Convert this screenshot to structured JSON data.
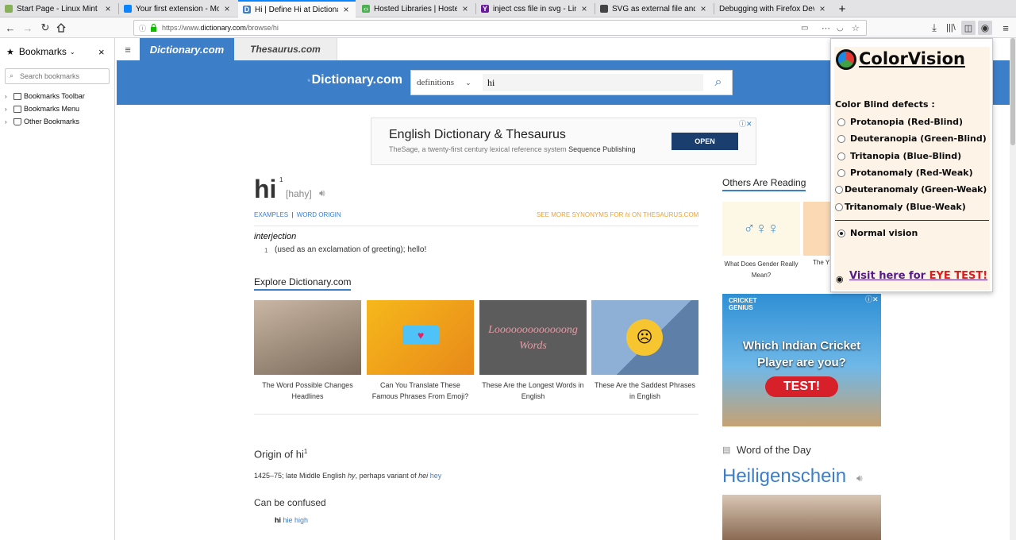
{
  "tabs": [
    {
      "title": "Start Page - Linux Mint",
      "fav_color": "#87b158"
    },
    {
      "title": "Your first extension - Mozilla",
      "fav_color": "#0a84ff"
    },
    {
      "title": "Hi | Define Hi at Dictionary.co",
      "fav_color": "#3d7ec9"
    },
    {
      "title": "Hosted Libraries  |  Hosted Li",
      "fav_color": "#4caf50"
    },
    {
      "title": "inject css file in svg - LinuxMi",
      "fav_color": "#6a1b9a"
    },
    {
      "title": "SVG as external file and CSS -",
      "fav_color": "#444444"
    },
    {
      "title": "Debugging with Firefox Develope",
      "fav_color": "#cccccc"
    }
  ],
  "url": {
    "prefix": "https://www.",
    "domain": "dictionary.com",
    "path": "/browse/hi"
  },
  "sidebar": {
    "title": "Bookmarks",
    "search_placeholder": "Search bookmarks",
    "items": [
      {
        "label": "Bookmarks Toolbar"
      },
      {
        "label": "Bookmarks Menu"
      },
      {
        "label": "Other Bookmarks"
      }
    ]
  },
  "site": {
    "tab_dictionary": "Dictionary.com",
    "tab_thesaurus": "Thesaurus.com",
    "logo_text": "Dictionary.com",
    "search_select": "definitions",
    "search_value": "hi"
  },
  "ad_top": {
    "title": "English Dictionary & Thesaurus",
    "subtitle": "TheSage, a twenty-first century lexical reference system",
    "sponsor": "Sequence Publishing",
    "button": "OPEN"
  },
  "entry": {
    "word": "hi",
    "superscript": "1",
    "pronunciation": "[hahy]",
    "nav_examples": "EXAMPLES",
    "nav_sep": "|",
    "nav_origin": "WORD ORIGIN",
    "synonyms_pre": "SEE MORE SYNONYMS FOR ",
    "synonyms_word": "hi",
    "synonyms_post": " ON THESAURUS.COM",
    "pos": "interjection",
    "def_num": "1",
    "definition": "(used as an exclamation of greeting); hello!"
  },
  "explore": {
    "heading": "Explore Dictionary.com",
    "items": [
      {
        "caption": "The Word Possible Changes Headlines",
        "color": "#9b8a7a"
      },
      {
        "caption": "Can You Translate These Famous Phrases From Emoji?",
        "color": "#f2a51b"
      },
      {
        "caption": "These Are the Longest Words in English",
        "color": "#5c5c5c",
        "overlay1": "Looooooooooooong",
        "overlay2": "Words"
      },
      {
        "caption": "These Are the Saddest Phrases in English",
        "color": "#7fa0c9"
      }
    ]
  },
  "origin": {
    "heading": "Origin of hi",
    "sup": "1",
    "text_pre": "1425–75; late Middle English ",
    "hy": "hy",
    "text_mid": ", perhaps variant of ",
    "hei": "hei",
    "hey": "hey"
  },
  "confused": {
    "heading": "Can be confused",
    "word": "hi",
    "hie": "hie",
    "high": "high"
  },
  "right_col": {
    "others_heading": "Others Are Reading",
    "card1_caption": "What Does Gender Really Mean?",
    "card2_caption": "The Y",
    "ad2_brand": "CRICKET GENIUS",
    "ad2_line1": "Which Indian Cricket",
    "ad2_line2": "Player are you?",
    "ad2_button": "TEST!",
    "wotd_label": "Word of the Day",
    "wotd_word": "Heiligenschein"
  },
  "popup": {
    "title": "ColorVision",
    "section": "Color Blind defects :",
    "options": [
      {
        "label": "Protanopia (Red-Blind)",
        "checked": false
      },
      {
        "label": "Deuteranopia (Green-Blind)",
        "checked": false
      },
      {
        "label": "Tritanopia (Blue-Blind)",
        "checked": false
      },
      {
        "label": "Protanomaly (Red-Weak)",
        "checked": false
      },
      {
        "label": "Deuteranomaly (Green-Weak)",
        "checked": false
      },
      {
        "label": "Tritanomaly (Blue-Weak)",
        "checked": false
      }
    ],
    "normal": {
      "label": "Normal vision",
      "checked": true
    },
    "link_pre": "Visit here for ",
    "link_em": "EYE TEST!"
  },
  "colors": {
    "brand_blue": "#3d7ec9",
    "accent_orange": "#e8a33a",
    "link_red": "#e01b1b",
    "link_purple": "#551a8b"
  }
}
